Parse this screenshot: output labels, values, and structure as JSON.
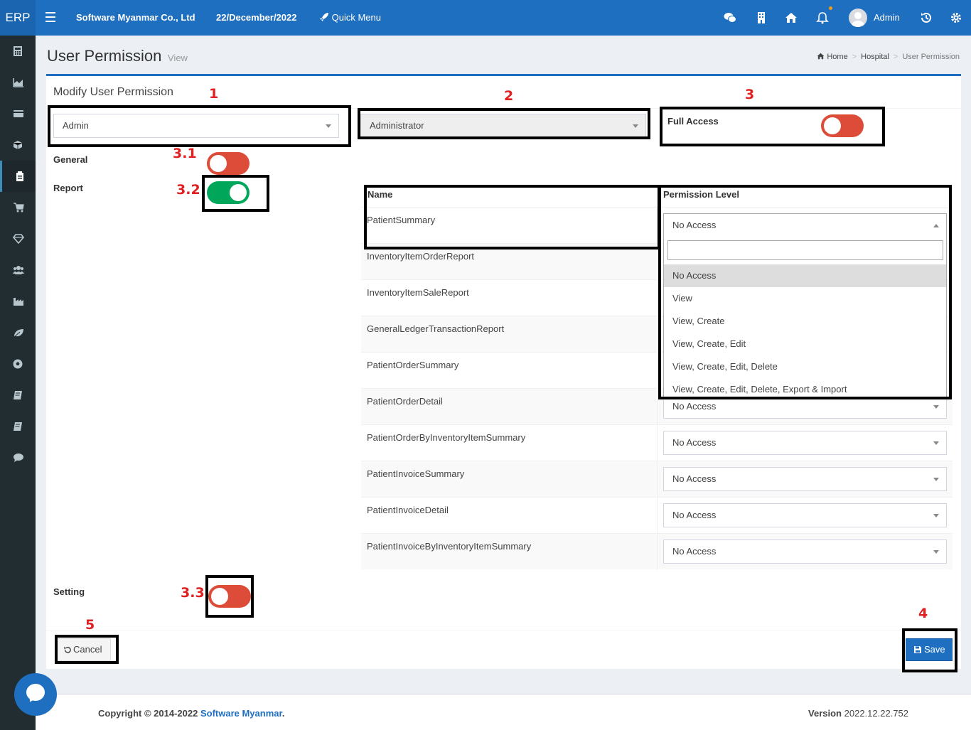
{
  "header": {
    "logo": "ERP",
    "company": "Software Myanmar Co., Ltd",
    "date": "22/December/2022",
    "quick_menu": "Quick Menu",
    "user": "Admin"
  },
  "page": {
    "title": "User Permission",
    "subtitle": "View",
    "breadcrumb": [
      "Home",
      "Hospital",
      "User Permission"
    ]
  },
  "form": {
    "box_title": "Modify User Permission",
    "user_select": "Admin",
    "role_select": "Administrator",
    "full_access_label": "Full Access",
    "full_access": false,
    "sections": [
      {
        "label": "General",
        "enabled": false
      },
      {
        "label": "Report",
        "enabled": true
      },
      {
        "label": "Setting",
        "enabled": false
      }
    ]
  },
  "table": {
    "col_name": "Name",
    "col_perm": "Permission Level",
    "rows": [
      {
        "name": "PatientSummary",
        "perm": "No Access"
      },
      {
        "name": "InventoryItemOrderReport",
        "perm": ""
      },
      {
        "name": "InventoryItemSaleReport",
        "perm": ""
      },
      {
        "name": "GeneralLedgerTransactionReport",
        "perm": ""
      },
      {
        "name": "PatientOrderSummary",
        "perm": ""
      },
      {
        "name": "PatientOrderDetail",
        "perm": "No Access"
      },
      {
        "name": "PatientOrderByInventoryItemSummary",
        "perm": "No Access"
      },
      {
        "name": "PatientInvoiceSummary",
        "perm": "No Access"
      },
      {
        "name": "PatientInvoiceDetail",
        "perm": "No Access"
      },
      {
        "name": "PatientInvoiceByInventoryItemSummary",
        "perm": "No Access"
      }
    ]
  },
  "dropdown": {
    "search_value": "",
    "options": [
      "No Access",
      "View",
      "View, Create",
      "View, Create, Edit",
      "View, Create, Edit, Delete",
      "View, Create, Edit, Delete, Export & Import"
    ],
    "selected": "No Access"
  },
  "annotations": {
    "a1": "1",
    "a2": "2",
    "a3": "3",
    "a31": "3.1",
    "a32": "3.2",
    "a33": "3.3",
    "a4": "4",
    "a5": "5"
  },
  "buttons": {
    "cancel": "Cancel",
    "save": "Save"
  },
  "footer": {
    "copyright_prefix": "Copyright © 2014-2022 ",
    "copyright_link": "Software Myanmar",
    "copyright_suffix": ".",
    "version_label": "Version",
    "version_value": "2022.12.22.752"
  },
  "colors": {
    "primary": "#1f6fc0",
    "sidebar": "#222d32",
    "toggle_off": "#dd4b39",
    "toggle_on": "#00a65a",
    "annotation": "#e02020"
  }
}
